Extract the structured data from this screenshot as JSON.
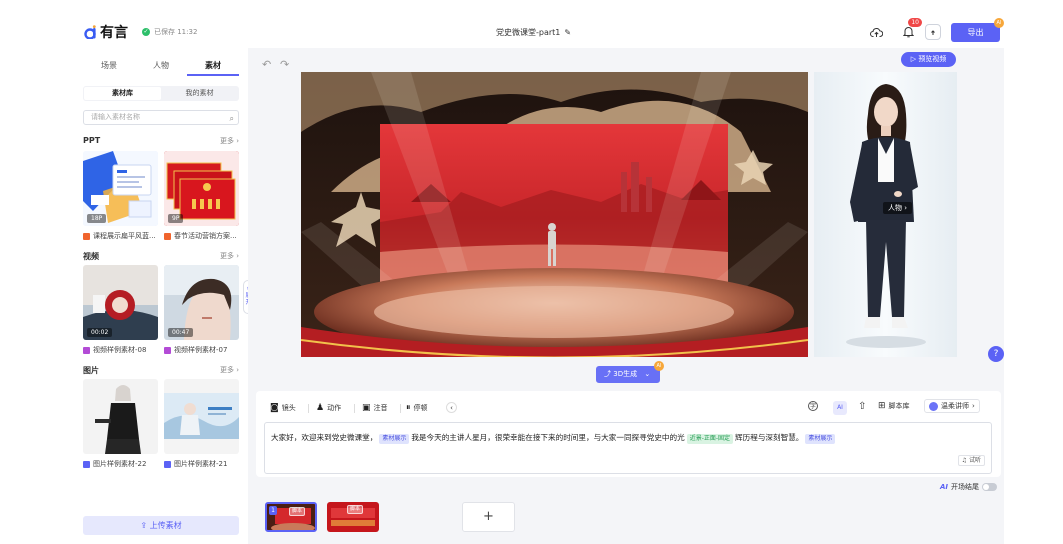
{
  "header": {
    "logo_text": "有言",
    "saved_text": "已保存 11:32",
    "doc_title": "党史微课堂-part1",
    "notification_count": "10",
    "export_label": "导出",
    "ai_badge": "AI"
  },
  "sidebar": {
    "tabs": [
      "场景",
      "人物",
      "素材"
    ],
    "active_tab": "素材",
    "segments": [
      "素材库",
      "我的素材"
    ],
    "search_placeholder": "请输入素材名称",
    "more_label": "更多",
    "sections": [
      {
        "title": "PPT",
        "items": [
          {
            "caption": "课程展示扁平风蓝...",
            "tag": "18P"
          },
          {
            "caption": "春节活动营销方案...",
            "tag": "9P"
          }
        ]
      },
      {
        "title": "视频",
        "items": [
          {
            "caption": "视频样例素材-08",
            "tag": "00:02"
          },
          {
            "caption": "视频样例素材-07",
            "tag": "00:47"
          }
        ]
      },
      {
        "title": "图片",
        "items": [
          {
            "caption": "图片样例素材-22",
            "tag": ""
          },
          {
            "caption": "图片样例素材-21",
            "tag": ""
          }
        ]
      }
    ],
    "upload_label": "上传素材",
    "expand_label": "展开"
  },
  "canvas": {
    "preview_label": "预览视频",
    "person_label": "人物",
    "gen3d_label": "3D生成",
    "help_label": "?"
  },
  "editor": {
    "tools": [
      "镜头",
      "动作",
      "注音",
      "停顿"
    ],
    "script_lib": "脚本库",
    "voice": "温柔讲师",
    "script_parts": [
      {
        "text": "大家好，欢迎来到党史微课堂，"
      },
      {
        "tag": "素材展示",
        "tone": "blue"
      },
      {
        "text": "我是今天的主讲人星月，很荣幸能在接下来的时间里，与大家一同探寻党史中的光"
      },
      {
        "tag": "近景-正面-固定",
        "tone": "green"
      },
      {
        "text": "辉历程与深刻智慧。"
      },
      {
        "tag": "素材展示",
        "tone": "blue"
      }
    ],
    "listen_label": "试听",
    "opening_tail_label": "开场结尾"
  },
  "timeline": {
    "scene_number": "1",
    "scene_tag": "脚本",
    "add_label": "+"
  },
  "colors": {
    "accent": "#5b62f5",
    "success": "#2dbf6a",
    "alert": "#f04848"
  }
}
